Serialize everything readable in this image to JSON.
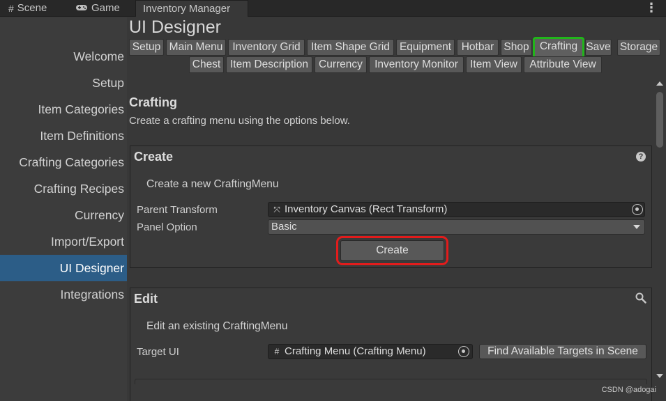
{
  "tabs": {
    "scene": "Scene",
    "game": "Game",
    "inventory_manager": "Inventory Manager"
  },
  "sidebar": {
    "items": [
      {
        "label": "Welcome"
      },
      {
        "label": "Setup"
      },
      {
        "label": "Item Categories"
      },
      {
        "label": "Item Definitions"
      },
      {
        "label": "Crafting Categories"
      },
      {
        "label": "Crafting Recipes"
      },
      {
        "label": "Currency"
      },
      {
        "label": "Import/Export"
      },
      {
        "label": "UI Designer",
        "active": true
      },
      {
        "label": "Integrations"
      }
    ]
  },
  "main": {
    "title": "UI Designer",
    "toolbar_row1": [
      "Setup",
      "Main Menu",
      "Inventory Grid",
      "Item Shape Grid",
      "Equipment",
      "Hotbar",
      "Shop",
      "Crafting",
      "Save",
      "Storage"
    ],
    "toolbar_row2": [
      "Chest",
      "Item Description",
      "Currency",
      "Inventory Monitor",
      "Item View",
      "Attribute View"
    ],
    "active_tool": "Crafting",
    "section_title": "Crafting",
    "section_desc": "Create a crafting menu using the options below."
  },
  "create_box": {
    "header": "Create",
    "subtitle": "Create a new CraftingMenu",
    "parent_transform_label": "Parent Transform",
    "parent_transform_value": "Inventory Canvas (Rect Transform)",
    "panel_option_label": "Panel Option",
    "panel_option_value": "Basic",
    "create_button": "Create"
  },
  "edit_box": {
    "header": "Edit",
    "subtitle": "Edit an existing CraftingMenu",
    "target_ui_label": "Target UI",
    "target_ui_value": "Crafting Menu (Crafting Menu)",
    "find_button": "Find Available Targets in Scene"
  },
  "watermark": "CSDN @adogai",
  "colors": {
    "active_sidebar": "#2c5d87",
    "highlight_green": "#21b51a",
    "highlight_red": "#e21c1c"
  }
}
